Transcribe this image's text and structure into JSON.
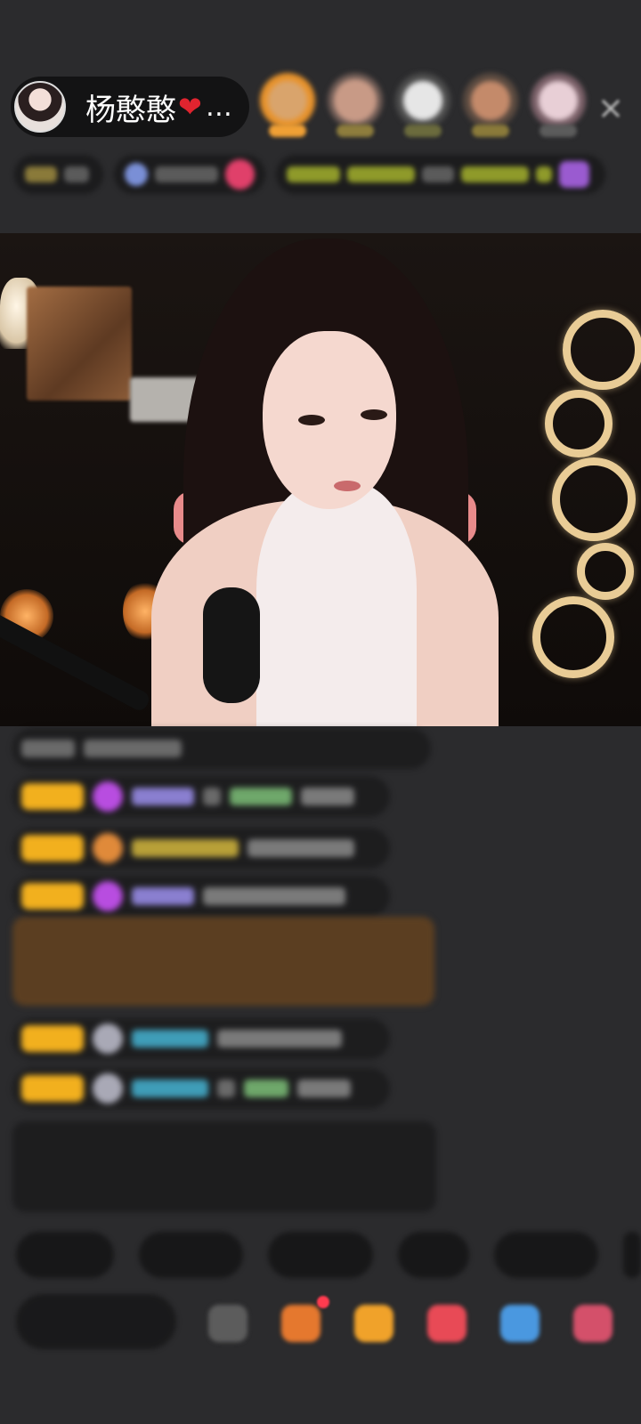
{
  "host": {
    "name": "杨憨憨",
    "heart": "❤",
    "ellipsis": "…"
  },
  "close_icon": "×",
  "colors": {
    "background": "#2b2b2d",
    "badge_yellow": "#f2b01e",
    "gift_card": "#6c461e",
    "heart_red": "#e0242f"
  },
  "icons": [
    "avatar",
    "close-icon",
    "gem-icon",
    "gift-icon",
    "chat-icon",
    "share-icon"
  ]
}
